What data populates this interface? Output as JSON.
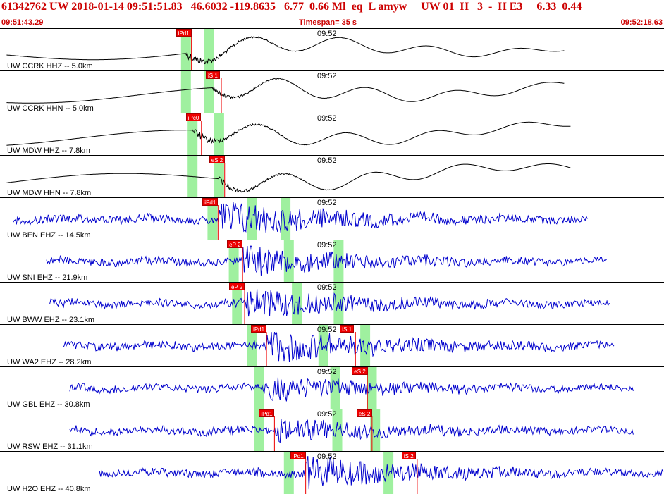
{
  "header": {
    "title": "61342762 UW 2018-01-14 09:51:51.83   46.6032 -119.8635   6.77  0.66 Ml  eq  L amyw     UW 01  H   3  -  H E3     6.33  0.44",
    "time_start": "09:51:43.29",
    "timespan": "Timespan=  35 s",
    "time_end": "09:52:18.63"
  },
  "colors": {
    "trace_broadband": "#000000",
    "trace_short": "#0000cc",
    "pick": "#ee0000",
    "window": "#9ff09f",
    "header_text": "#cc0000"
  },
  "panels": [
    {
      "label": "UW CCRK HHZ -- 5.0km",
      "tick": "09:52",
      "type": "long",
      "start": 0.01,
      "end": 0.85,
      "onset": 0.28,
      "amp": 0.45,
      "windows": [
        0.28,
        0.315
      ],
      "picks": [
        {
          "label": "iPd1",
          "pos": 0.265
        }
      ]
    },
    {
      "label": "UW CCRK HHN -- 5.0km",
      "tick": "09:52",
      "type": "long",
      "start": 0.01,
      "end": 0.85,
      "onset": 0.32,
      "amp": 0.25,
      "windows": [
        0.28,
        0.315
      ],
      "picks": [
        {
          "label": "iS 1",
          "pos": 0.31
        }
      ]
    },
    {
      "label": "UW MDW HHZ -- 7.8km",
      "tick": "09:52",
      "type": "long",
      "start": 0.01,
      "end": 0.86,
      "onset": 0.29,
      "amp": 0.4,
      "windows": [
        0.29,
        0.33
      ],
      "picks": [
        {
          "label": "iPc0",
          "pos": 0.28
        }
      ]
    },
    {
      "label": "UW MDW HHN -- 7.8km",
      "tick": "09:52",
      "type": "long",
      "start": 0.01,
      "end": 0.86,
      "onset": 0.33,
      "amp": 0.3,
      "windows": [
        0.29,
        0.33
      ],
      "picks": [
        {
          "label": "eS 2",
          "pos": 0.315
        }
      ]
    },
    {
      "label": "UW BEN EHZ -- 14.5km",
      "tick": "09:52",
      "type": "short",
      "start": 0.02,
      "end": 0.885,
      "onset": 0.33,
      "amp": 0.42,
      "windows": [
        0.32,
        0.38,
        0.43
      ],
      "picks": [
        {
          "label": "iPd1",
          "pos": 0.305
        }
      ]
    },
    {
      "label": "UW SNI EHZ -- 21.9km",
      "tick": "09:52",
      "type": "short",
      "start": 0.07,
      "end": 0.915,
      "onset": 0.365,
      "amp": 0.33,
      "windows": [
        0.352,
        0.435,
        0.51
      ],
      "picks": [
        {
          "label": "eP 2",
          "pos": 0.342
        }
      ]
    },
    {
      "label": "UW BWW EHZ -- 23.1km",
      "tick": "09:52",
      "type": "short",
      "start": 0.075,
      "end": 0.92,
      "onset": 0.37,
      "amp": 0.33,
      "windows": [
        0.357,
        0.447,
        0.51
      ],
      "picks": [
        {
          "label": "eP 2",
          "pos": 0.345
        }
      ]
    },
    {
      "label": "UW WA2 EHZ -- 28.2km",
      "tick": "09:52",
      "type": "short",
      "start": 0.095,
      "end": 0.925,
      "onset": 0.4,
      "amp": 0.36,
      "windows": [
        0.38,
        0.487,
        0.55
      ],
      "picks": [
        {
          "label": "iPd1",
          "pos": 0.378
        },
        {
          "label": "iS 1",
          "pos": 0.512
        }
      ]
    },
    {
      "label": "UW GBL EHZ -- 30.8km",
      "tick": "09:52",
      "type": "short",
      "start": 0.105,
      "end": 0.955,
      "onset": 0.405,
      "amp": 0.25,
      "windows": [
        0.39,
        0.505,
        0.56
      ],
      "picks": [
        {
          "label": "eS 2",
          "pos": 0.53
        }
      ]
    },
    {
      "label": "UW RSW EHZ -- 31.1km",
      "tick": "09:52",
      "type": "short",
      "start": 0.105,
      "end": 0.955,
      "onset": 0.42,
      "amp": 0.24,
      "windows": [
        0.39,
        0.508,
        0.565
      ],
      "picks": [
        {
          "label": "iPd1",
          "pos": 0.39
        },
        {
          "label": "eS 2",
          "pos": 0.537
        }
      ]
    },
    {
      "label": "UW H2O EHZ -- 40.8km",
      "tick": "09:52",
      "type": "short",
      "start": 0.15,
      "end": 1.0,
      "onset": 0.46,
      "amp": 0.36,
      "windows": [
        0.435,
        0.585
      ],
      "picks": [
        {
          "label": "iPd1",
          "pos": 0.437
        },
        {
          "label": "iS 2",
          "pos": 0.605
        }
      ]
    }
  ]
}
